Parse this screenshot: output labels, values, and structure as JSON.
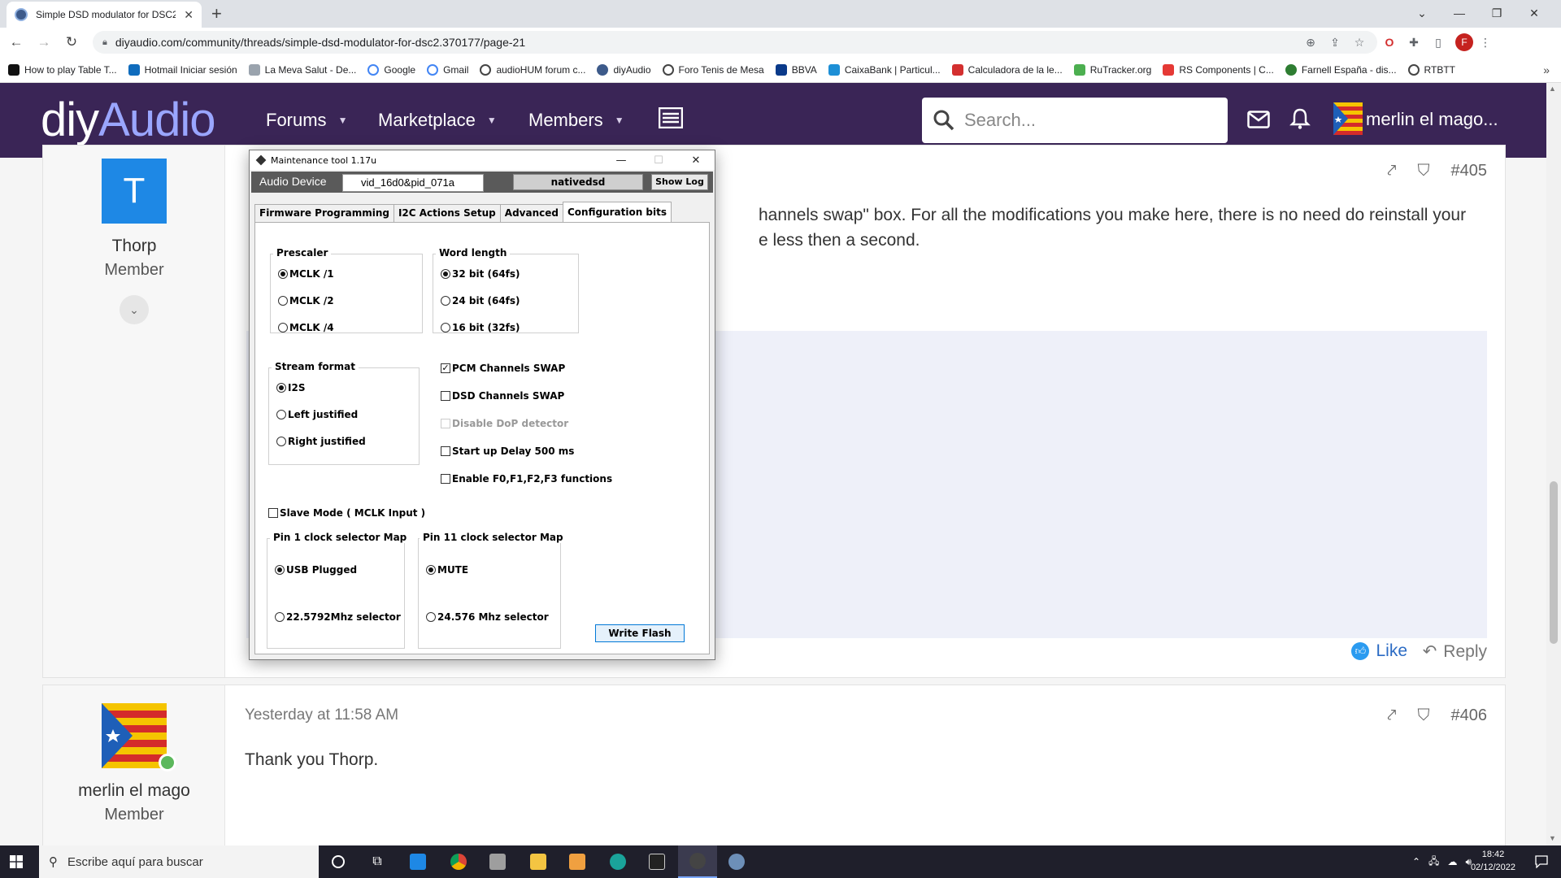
{
  "browser": {
    "tab_title": "Simple DSD modulator for DSC2",
    "tab_close": "✕",
    "new_tab": "+",
    "url": "diyaudio.com/community/threads/simple-dsd-modulator-for-dsc2.370177/page-21",
    "profile_initial": "F",
    "bookmarks": [
      {
        "label": "How to play Table T...",
        "color": "#111111"
      },
      {
        "label": "Hotmail Iniciar sesión",
        "color": "#0f6cbd"
      },
      {
        "label": "La Meva Salut - De...",
        "color": "#9aa3ad"
      },
      {
        "label": "Google",
        "color": "#ffffff"
      },
      {
        "label": "Gmail",
        "color": "#ffffff"
      },
      {
        "label": "audioHUM forum c...",
        "color": "#444444"
      },
      {
        "label": "diyAudio",
        "color": "#3d5a8a"
      },
      {
        "label": "Foro Tenis de Mesa",
        "color": "#444444"
      },
      {
        "label": "BBVA",
        "color": "#0a3a8a"
      },
      {
        "label": "CaixaBank | Particul...",
        "color": "#1d8fd6"
      },
      {
        "label": "Calculadora de la le...",
        "color": "#d32f2f"
      },
      {
        "label": "RuTracker.org",
        "color": "#4caf50"
      },
      {
        "label": "RS Components | C...",
        "color": "#e53935"
      },
      {
        "label": "Farnell España - dis...",
        "color": "#2e7d32"
      },
      {
        "label": "RTBTT",
        "color": "#444444"
      }
    ],
    "bookmarks_more": "»"
  },
  "site": {
    "logo_diy": "diy",
    "logo_audio": "Audio",
    "nav": {
      "forums": "Forums",
      "marketplace": "Marketplace",
      "members": "Members"
    },
    "search_placeholder": "Search...",
    "username": "merlin el mago..."
  },
  "posts": [
    {
      "author": "Thorp",
      "author_initial": "T",
      "role": "Member",
      "number": "#405",
      "text_line1": "hannels swap\" box. For all the modifications you make here, there is no need do reinstall your",
      "text_line2": "e less then a second.",
      "like_label": "Like",
      "reply_label": "Reply"
    },
    {
      "author": "merlin el mago",
      "role": "Member",
      "date": "Yesterday at 11:58 AM",
      "number": "#406",
      "text": "Thank you Thorp."
    }
  ],
  "tool": {
    "title": "Maintenance tool 1.17u",
    "device_label": "Audio Device",
    "device_value": "vid_16d0&pid_071a",
    "mode": "nativedsd",
    "show_log": "Show Log",
    "tabs": [
      "Firmware Programming",
      "I2C Actions Setup",
      "Advanced",
      "Configuration bits"
    ],
    "active_tab": 3,
    "prescaler": {
      "label": "Prescaler",
      "options": [
        "MCLK /1",
        "MCLK /2",
        "MCLK /4"
      ],
      "selected": 0
    },
    "word_length": {
      "label": "Word length",
      "options": [
        "32 bit (64fs)",
        "24 bit (64fs)",
        "16 bit (32fs)"
      ],
      "selected": 0
    },
    "stream_format": {
      "label": "Stream format",
      "options": [
        "I2S",
        "Left justified",
        "Right justified"
      ],
      "selected": 0
    },
    "checks": [
      {
        "label": "PCM Channels SWAP",
        "checked": true,
        "disabled": false
      },
      {
        "label": "DSD Channels SWAP",
        "checked": false,
        "disabled": false
      },
      {
        "label": "Disable DoP detector",
        "checked": false,
        "disabled": true
      },
      {
        "label": "Start up Delay 500 ms",
        "checked": false,
        "disabled": false
      },
      {
        "label": "Enable F0,F1,F2,F3 functions",
        "checked": false,
        "disabled": false
      }
    ],
    "slave_mode": {
      "label": "Slave Mode ( MCLK Input )",
      "checked": false
    },
    "pin1": {
      "label": "Pin 1 clock selector Map",
      "options": [
        "USB Plugged",
        "22.5792Mhz selector"
      ],
      "selected": 0
    },
    "pin11": {
      "label": "Pin 11 clock selector Map",
      "options": [
        "MUTE",
        "24.576 Mhz selector"
      ],
      "selected": 0
    },
    "write_flash": "Write Flash"
  },
  "taskbar": {
    "search_placeholder": "Escribe aquí para buscar",
    "time": "18:42",
    "date": "02/12/2022"
  }
}
